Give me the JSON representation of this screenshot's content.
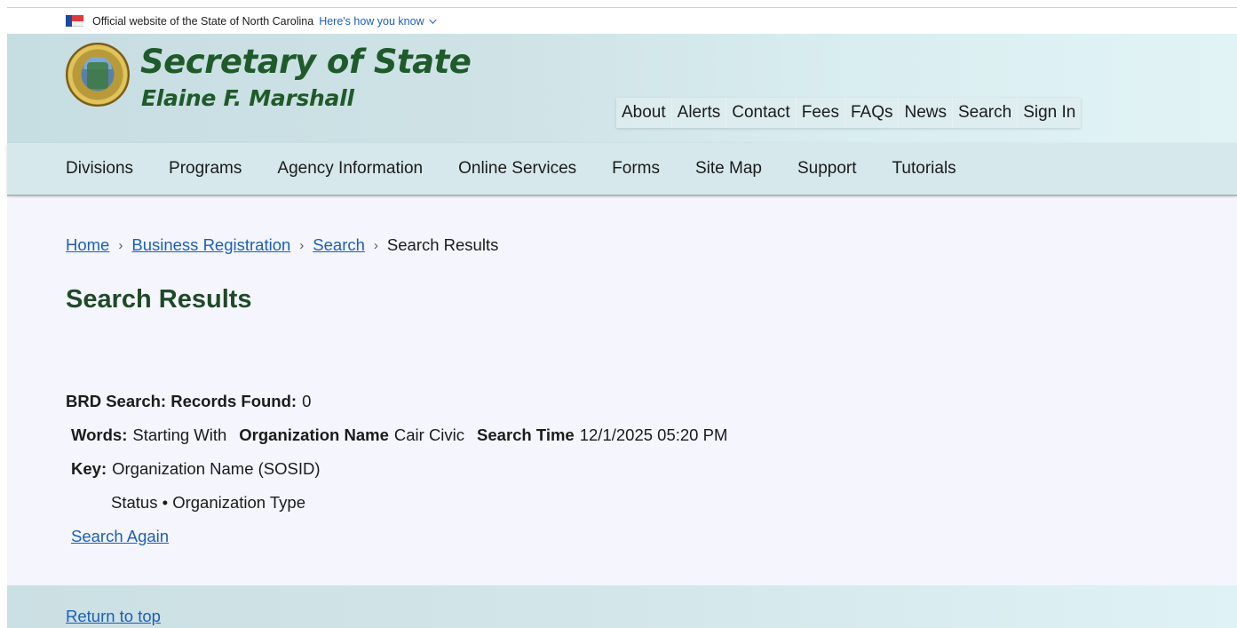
{
  "official_banner": {
    "text": "Official website of the State of North Carolina",
    "link": "Here's how you know"
  },
  "header": {
    "title": "Secretary of State",
    "subtitle": "Elaine F. Marshall",
    "utility_nav": [
      "About",
      "Alerts",
      "Contact",
      "Fees",
      "FAQs",
      "News",
      "Search",
      "Sign In"
    ]
  },
  "main_nav": [
    "Divisions",
    "Programs",
    "Agency Information",
    "Online Services",
    "Forms",
    "Site Map",
    "Support",
    "Tutorials"
  ],
  "breadcrumb": {
    "home": "Home",
    "business_registration": "Business Registration",
    "search": "Search",
    "current": "Search Results"
  },
  "page": {
    "title": "Search Results",
    "records_label": "BRD Search: Records Found:",
    "records_count": "0",
    "words_label": "Words:",
    "words_value": "Starting With",
    "org_name_label": "Organization Name",
    "org_name_value": "Cair Civic",
    "search_time_label": "Search Time",
    "search_time_value": "12/1/2025 05:20 PM",
    "key_label": "Key:",
    "key_value": "Organization Name (SOSID)",
    "status_line": "Status • Organization Type",
    "search_again": "Search Again"
  },
  "footer": {
    "return_to_top": "Return to top"
  },
  "colors": {
    "title_green": "#1f5a2a",
    "link_blue": "#1d5fb4",
    "content_bg": "#f4f5fd"
  }
}
